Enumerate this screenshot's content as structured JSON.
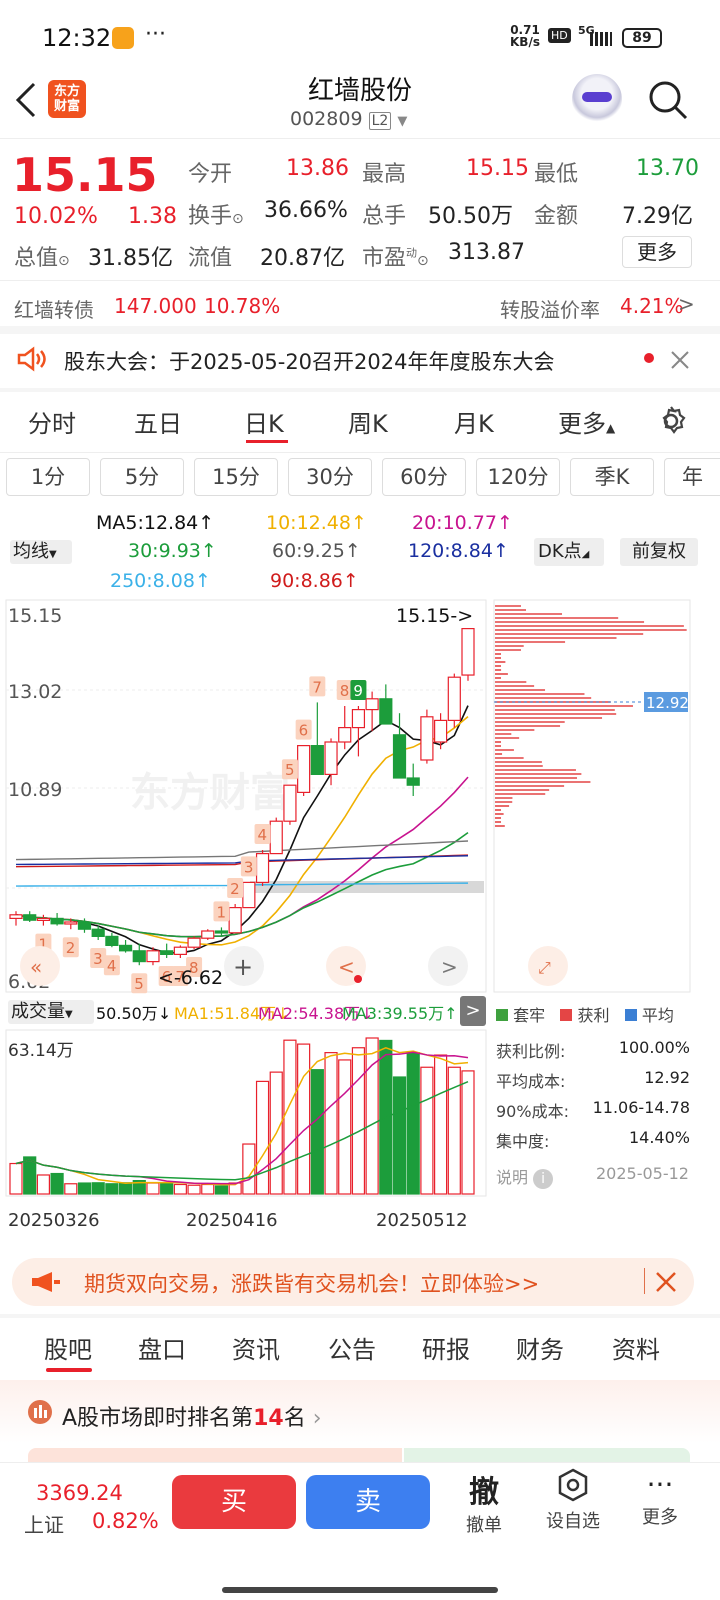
{
  "status": {
    "time": "12:32",
    "dots": "···",
    "net_speed_top": "0.71",
    "net_speed_bottom": "KB/s",
    "hd": "HD",
    "signal": "5G",
    "battery": "89"
  },
  "header": {
    "logo_line1": "东方",
    "logo_line2": "财富",
    "title": "红墙股份",
    "code": "002809",
    "level": "L2"
  },
  "quote": {
    "price": "15.15",
    "pct": "10.02%",
    "change": "1.38",
    "open_label": "今开",
    "open": "13.86",
    "high_label": "最高",
    "high": "15.15",
    "low_label": "最低",
    "low": "13.70",
    "turnover_label": "换手",
    "turnover": "36.66%",
    "volume_label": "总手",
    "volume": "50.50万",
    "amount_label": "金额",
    "amount": "7.29亿",
    "mcap_label": "总值",
    "mcap": "31.85亿",
    "float_label": "流值",
    "float": "20.87亿",
    "pe_label": "市盈",
    "pe_sup": "动",
    "pe": "313.87",
    "more": "更多"
  },
  "bond": {
    "name": "红墙转债",
    "price": "147.000",
    "pct": "10.78%",
    "premium_label": "转股溢价率",
    "premium": "4.21%"
  },
  "notice": {
    "text": "股东大会：于2025-05-20召开2024年年度股东大会"
  },
  "chart_tabs": [
    "分时",
    "五日",
    "日K",
    "周K",
    "月K",
    "更多"
  ],
  "period_tabs": [
    "1分",
    "5分",
    "15分",
    "30分",
    "60分",
    "120分",
    "季K",
    "年"
  ],
  "ma_line1": {
    "ma5": "MA5:12.84",
    "m10": "10:12.48",
    "m20": "20:10.77"
  },
  "ma_line2": {
    "type": "均线",
    "m30": "30:9.93",
    "m60": "60:9.25",
    "m120": "120:8.84",
    "dk": "DK点",
    "fq": "前复权"
  },
  "ma_line3": {
    "m250": "250:8.08",
    "m90": "90:8.86"
  },
  "axis": {
    "p1": "15.15",
    "p2": "13.02",
    "p3": "10.89",
    "p4": "6.62",
    "last": "15.15->",
    "low_mark": "<-6.62",
    "avg_cost": "12.92",
    "watermark": "东方财富"
  },
  "vol": {
    "label": "成交量",
    "value": "50.50万",
    "ma1": "MA1:51.84万",
    "ma2": "MA2:54.38万",
    "ma3": "MA3:39.55万",
    "max": "63.14万",
    "dates": [
      "20250326",
      "20250416",
      "20250512"
    ]
  },
  "chips": {
    "legend": [
      "套牢",
      "获利",
      "平均"
    ],
    "rows": [
      [
        "获利比例:",
        "100.00%"
      ],
      [
        "平均成本:",
        "12.92"
      ],
      [
        "90%成本:",
        "11.06-14.78"
      ],
      [
        "集中度:",
        "14.40%"
      ]
    ],
    "note": "说明",
    "date": "2025-05-12"
  },
  "ad": {
    "text": "期货双向交易，涨跌皆有交易机会！立即体验>>"
  },
  "bottom_tabs": [
    "股吧",
    "盘口",
    "资讯",
    "公告",
    "研报",
    "财务",
    "资料"
  ],
  "rank": {
    "prefix": "A股市场即时排名第",
    "num": "14",
    "suffix": "名"
  },
  "footer": {
    "index": "3369.24",
    "index_name": "上证",
    "index_pct": "0.82%",
    "buy": "买",
    "sell": "卖",
    "cancel_icon": "撤",
    "cancel": "撤单",
    "watch": "设自选",
    "more": "更多"
  },
  "chart_data": [
    {
      "type": "candlestick",
      "title": "日K",
      "x_range": [
        "20250326",
        "20250512"
      ],
      "ylim": [
        6.62,
        15.15
      ],
      "ohlc": [
        [
          7.1,
          7.3,
          6.9,
          7.2
        ],
        [
          7.2,
          7.3,
          7.0,
          7.05
        ],
        [
          7.05,
          7.2,
          6.9,
          7.1
        ],
        [
          7.1,
          7.25,
          6.9,
          6.95
        ],
        [
          6.95,
          7.1,
          6.8,
          7.0
        ],
        [
          7.0,
          7.1,
          6.7,
          6.8
        ],
        [
          6.8,
          6.9,
          6.5,
          6.6
        ],
        [
          6.6,
          6.7,
          6.3,
          6.35
        ],
        [
          6.35,
          6.5,
          6.15,
          6.2
        ],
        [
          6.2,
          6.4,
          5.8,
          5.9
        ],
        [
          5.9,
          6.3,
          5.8,
          6.2
        ],
        [
          6.2,
          6.4,
          6.0,
          6.1
        ],
        [
          6.1,
          6.35,
          6.0,
          6.3
        ],
        [
          6.3,
          6.6,
          6.25,
          6.55
        ],
        [
          6.55,
          6.8,
          6.5,
          6.75
        ],
        [
          6.75,
          6.85,
          6.6,
          6.7
        ],
        [
          6.7,
          7.5,
          6.7,
          7.4
        ],
        [
          7.4,
          8.1,
          7.4,
          8.1
        ],
        [
          8.1,
          9.0,
          8.0,
          8.9
        ],
        [
          8.9,
          9.9,
          8.9,
          9.8
        ],
        [
          9.8,
          10.8,
          9.7,
          10.8
        ],
        [
          10.6,
          11.9,
          10.5,
          11.9
        ],
        [
          11.9,
          13.1,
          11.2,
          11.1
        ],
        [
          11.1,
          12.1,
          10.8,
          12.0
        ],
        [
          12.0,
          13.0,
          11.8,
          12.4
        ],
        [
          12.4,
          13.0,
          11.6,
          12.9
        ],
        [
          12.9,
          13.4,
          12.3,
          13.2
        ],
        [
          13.2,
          13.6,
          12.5,
          12.5
        ],
        [
          12.2,
          12.8,
          11.0,
          11.0
        ],
        [
          11.0,
          11.4,
          10.5,
          10.8
        ],
        [
          11.5,
          12.9,
          11.4,
          12.7
        ],
        [
          12.0,
          12.8,
          11.8,
          12.6
        ],
        [
          12.6,
          13.9,
          12.4,
          13.8
        ],
        [
          13.86,
          15.15,
          13.7,
          15.15
        ]
      ],
      "volumes": [
        12.5,
        15.2,
        7.8,
        8.4,
        4.2,
        4.5,
        4.6,
        4.2,
        4.6,
        5.5,
        4.5,
        4.5,
        3.9,
        3.6,
        3.9,
        3.3,
        4.5,
        20.5,
        46.2,
        50.0,
        63.1,
        61.5,
        51.0,
        58.0,
        55.0,
        60.0,
        64.0,
        63.0,
        48.0,
        58.0,
        52.0,
        57.0,
        52.0,
        50.5
      ],
      "ma_latest": {
        "MA5": 12.84,
        "MA10": 12.48,
        "MA20": 10.77,
        "MA30": 9.93,
        "MA60": 9.25,
        "MA90": 8.86,
        "MA120": 8.84,
        "MA250": 8.08
      },
      "volume_ma": {
        "MA1": "51.84万",
        "MA2": "54.38万",
        "MA3": "39.55万"
      },
      "y_ticks": [
        15.15,
        13.02,
        10.89,
        6.62
      ]
    }
  ]
}
